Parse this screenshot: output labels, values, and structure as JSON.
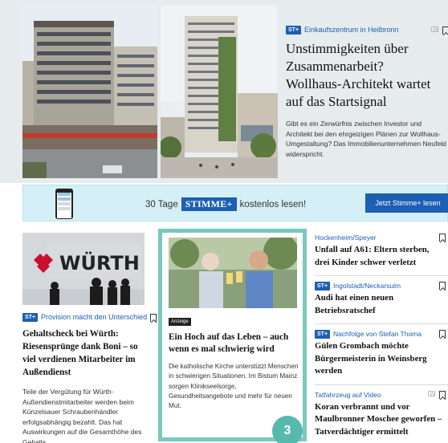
{
  "hero": {
    "badge": "ST+",
    "kicker": "Einkaufszentrum in Heilbronn",
    "title": "Unstimmigkeiten über Zusammenarbeit? Wollhaus-Architekt wartet auf das Startsignal",
    "teaser_lines": [
      "Gibt es ein Zerwürfnis zwischen Investor und",
      "Architekt bei den ehrgeizigen Plänen zur Wollhaus-",
      "Umgestaltung? Das Immobilienunternehmen Neufeld",
      "widerspricht."
    ],
    "icons": [
      "camera-icon",
      "bookmark-icon"
    ]
  },
  "promo": {
    "text_before": "30 Tage",
    "brand": "STIMME+",
    "text_after": "kostenlos lesen!",
    "button": "Jetzt Stimme+ lesen"
  },
  "left_article": {
    "image_sign": "WÜRTH",
    "badge": "ST+",
    "kicker": "Provision macht den Unterschied",
    "title": "Gehaltscheck bei Würth: Riesensprünge dank Boni – so viel verdienen Mitarbeiter im Außendienst",
    "teaser": "Teile der Vergütung für Würth-Außendienstmitarbeiter werden beim Künzelsauer Schraubenhändler erfolgsabhängig bezahlt. Das hat Auswirkungen auf die Gesamthöhe des Gehalts."
  },
  "ad_article": {
    "label": "Anzeige",
    "title": "Ein Hoch auf das Leben – auch wenn es mal schwierig wird",
    "teaser": "Die katholische Kirche unterstützt Menschen in schwierigen Situationen. Im Bistum Mainz sorgen Klinikseelsorge, Gesundheitsangebote und mehr für neuen Mut.",
    "number": "3"
  },
  "right_articles": [
    {
      "badge": "",
      "kicker": "Hockenheim/Speyer",
      "title": "Unfall auf A61: Eltern sterben, drei Kinder schwer verletzt"
    },
    {
      "badge": "ST+",
      "kicker": "Ingolstadt/Neckarsulm",
      "title": "Audi hat einen neuen Betriebsratschef"
    },
    {
      "badge": "ST+",
      "kicker": "Nachfolge von Stefan Thoma",
      "title": "Gülen Grombach möchte Bürgermeisterin in Weinsberg werden"
    },
    {
      "badge": "",
      "kicker": "Tatfahrzeug auf Video",
      "title": "Koran verbrannt und vor Maulbronner Moschee geworfen – Tatverdächtiger ermittelt"
    }
  ]
}
